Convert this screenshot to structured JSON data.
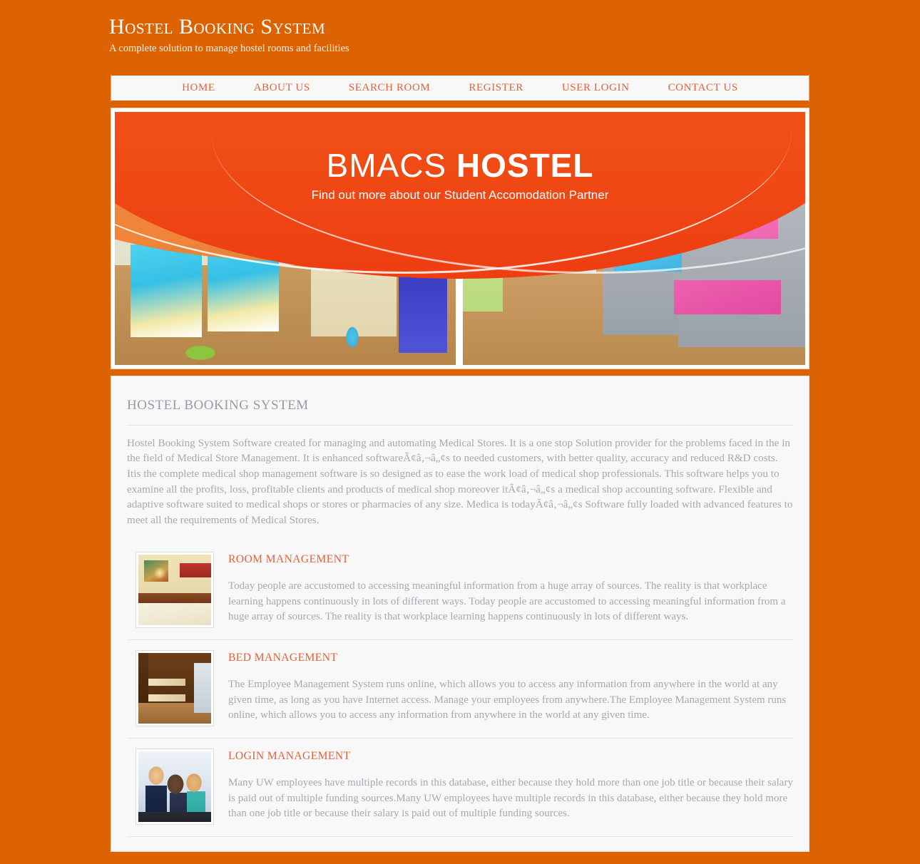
{
  "site": {
    "title": "Hostel Booking System",
    "tagline": "A complete solution to manage hostel rooms and facilities"
  },
  "nav": {
    "items": [
      {
        "label": "Home"
      },
      {
        "label": "About Us"
      },
      {
        "label": "Search Room"
      },
      {
        "label": "Register"
      },
      {
        "label": "User Login"
      },
      {
        "label": "Contact Us"
      }
    ]
  },
  "banner": {
    "title_thin": "BMACS",
    "title_bold": "HOSTEL",
    "subtitle": "Find out more about our Student Accomodation Partner",
    "alt": "hostel-rooms-banner-photo"
  },
  "main": {
    "section_title": "Hostel Booking System",
    "intro": "Hostel Booking System Software created for managing and automating Medical Stores. It is a one stop Solution provider for the problems faced in the in the field of Medical Store Management. It is enhanced softwareÃ¢â‚¬â„¢s to needed customers, with better quality, accuracy and reduced R&D costs. Itis the complete medical shop management software is so designed as to ease the work load of medical shop professionals. This software helps you to examine all the profits, loss, profitable clients and products of medical shop moreover itÃ¢â‚¬â„¢s a medical shop accounting software. Flexible and adaptive software suited to medical shops or stores or pharmacies of any size. Medica is todayÃ¢â‚¬â„¢s Software fully loaded with advanced features to meet all the requirements of Medical Stores.",
    "features": [
      {
        "title": "Room Management",
        "thumb": "hotel-bedroom-photo",
        "text": "Today people are accustomed to accessing meaningful information from a huge array of sources. The reality is that workplace learning happens continuously in lots of different ways. Today people are accustomed to accessing meaningful information from a huge array of sources. The reality is that workplace learning happens continuously in lots of different ways."
      },
      {
        "title": "Bed Management",
        "thumb": "bunk-bed-dorm-photo",
        "text": "The Employee Management System runs online, which allows you to access any information from anywhere in the world at any given time, as long as you have Internet access. Manage your employees from anywhere.The Employee Management System runs online, which allows you to access any information from anywhere in the world at any given time."
      },
      {
        "title": "Login Management",
        "thumb": "people-at-computer-photo",
        "text": "Many UW employees have multiple records in this database, either because they hold more than one job title or because their salary is paid out of multiple funding sources.Many UW employees have multiple records in this database, either because they hold more than one job title or because their salary is paid out of multiple funding sources."
      }
    ]
  },
  "colors": {
    "page_background": "#dd6202",
    "accent_orange": "#e2613a",
    "panel_background": "#f8f8f8",
    "body_text": "#a8a8b2",
    "section_title": "#9a9aa6"
  }
}
